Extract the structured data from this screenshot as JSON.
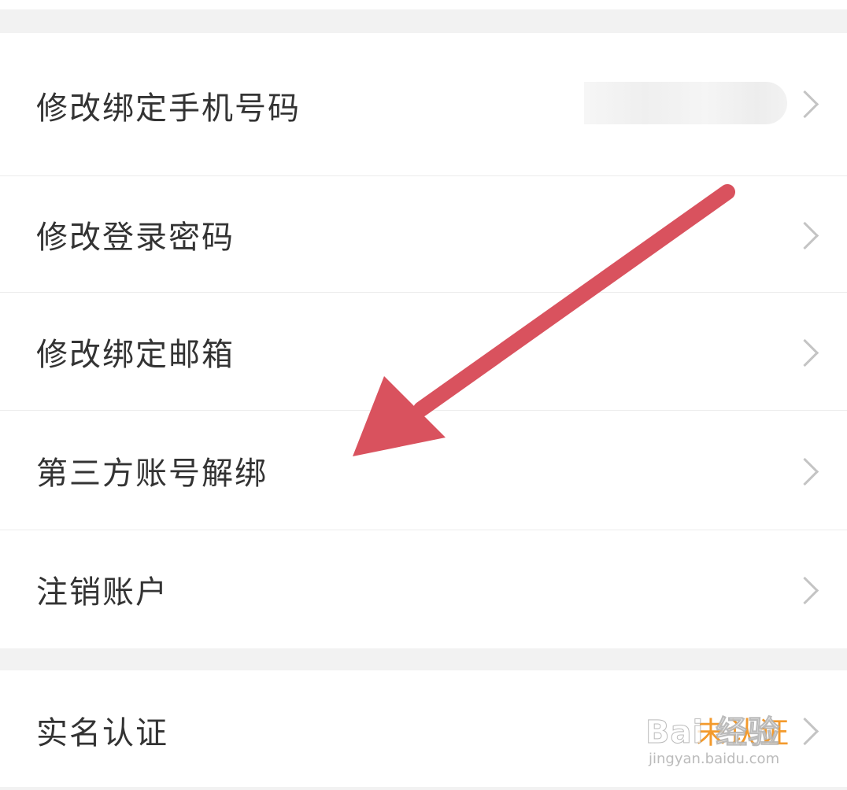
{
  "menu_section_1": {
    "items": [
      {
        "label": "修改绑定手机号码",
        "value_hidden": true
      },
      {
        "label": "修改登录密码"
      },
      {
        "label": "修改绑定邮箱"
      },
      {
        "label": "第三方账号解绑"
      },
      {
        "label": "注销账户"
      }
    ]
  },
  "menu_section_2": {
    "items": [
      {
        "label": "实名认证",
        "status": "未认证"
      }
    ]
  },
  "annotation": {
    "arrow_color": "#d9525e"
  },
  "watermark": {
    "logo_text": "Bai 经验",
    "url": "jingyan.baidu.com"
  },
  "colors": {
    "status_orange": "#f39a2c",
    "text_primary": "#333333",
    "chevron": "#c4c4c4",
    "background_gap": "#f2f2f2"
  }
}
